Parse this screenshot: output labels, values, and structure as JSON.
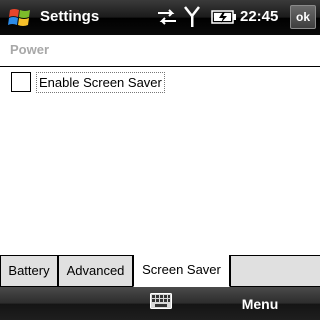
{
  "titlebar": {
    "title": "Settings",
    "time": "22:45",
    "ok_label": "ok",
    "icons": [
      "start-windows-logo-icon",
      "sync-arrows-icon",
      "signal-antenna-icon",
      "battery-charging-icon"
    ]
  },
  "section": {
    "header": "Power"
  },
  "options": {
    "screen_saver": {
      "label": "Enable Screen Saver",
      "checked": false
    }
  },
  "tabs": [
    {
      "label": "Battery",
      "selected": false
    },
    {
      "label": "Advanced",
      "selected": false
    },
    {
      "label": "Screen Saver",
      "selected": true
    }
  ],
  "softkeys": {
    "right_label": "Menu",
    "center_icon": "keyboard-icon"
  },
  "colors": {
    "bar_dark": "#000000",
    "section_header": "#a8a8a8",
    "tab_unselected": "#e0e0e0",
    "tab_selected": "#ffffff"
  }
}
